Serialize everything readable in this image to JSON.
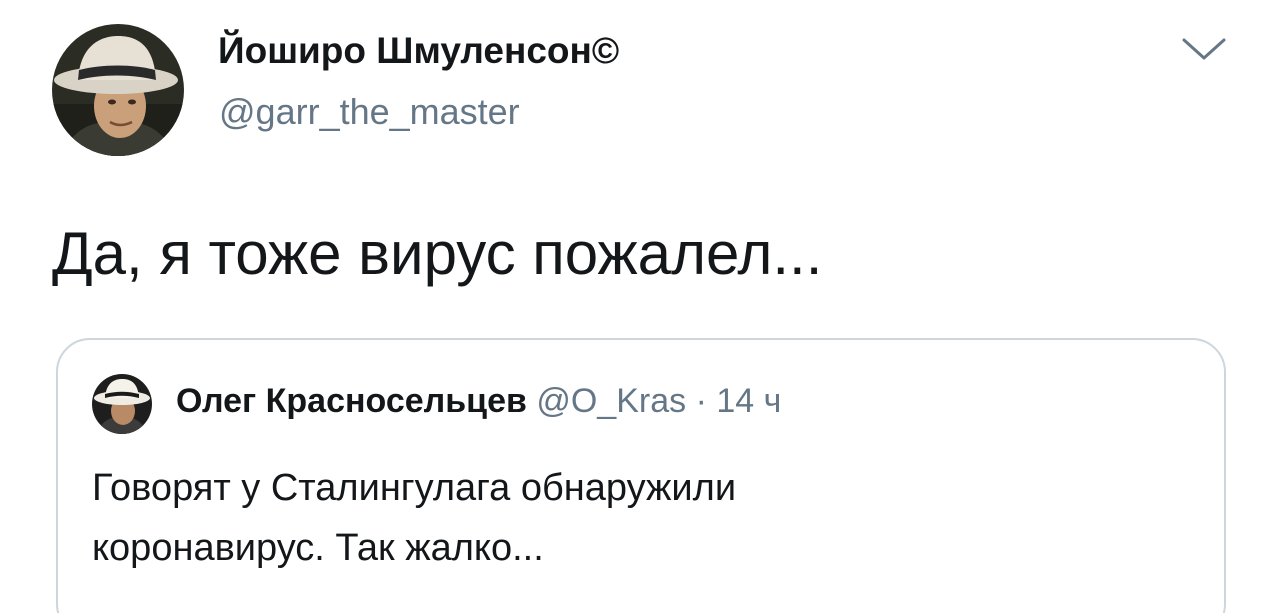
{
  "tweet": {
    "author": {
      "display_name": "Йоширо Шмуленсон©",
      "handle": "@garr_the_master",
      "avatar_icon": "user-avatar-fedora-icon"
    },
    "menu_icon": "chevron-down-icon",
    "text": "Да, я тоже вирус пожалел..."
  },
  "quoted_tweet": {
    "author": {
      "display_name": "Олег Красносельцев",
      "handle": "@O_Kras",
      "avatar_icon": "user-avatar-fedora-icon"
    },
    "separator": "·",
    "time": "14 ч",
    "text_lines": [
      "Говорят у Сталингулага обнаружили",
      "коронавирус. Так жалко..."
    ]
  },
  "colors": {
    "primary_text": "#14171a",
    "secondary_text": "#657786",
    "border": "#ccd6dd",
    "background": "#ffffff"
  }
}
